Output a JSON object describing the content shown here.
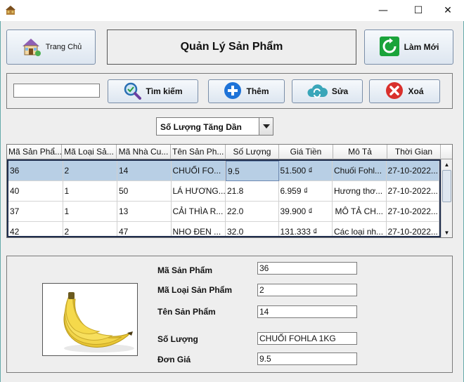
{
  "window": {
    "minimize": "—",
    "maximize": "☐",
    "close": "✕"
  },
  "header": {
    "home_label": "Trang Chủ",
    "title": "Quản Lý Sản Phẩm",
    "refresh_label": "Làm Mới"
  },
  "toolbar": {
    "search_value": "",
    "search_label": "Tìm kiếm",
    "add_label": "Thêm",
    "edit_label": "Sửa",
    "delete_label": "Xoá"
  },
  "sort": {
    "selected": "Số Lượng Tăng Dần"
  },
  "table": {
    "columns": [
      "Mã Sản Phẩ...",
      "Mã Loại Sả...",
      "Mã Nhà Cu...",
      "Tên Sản Ph...",
      "Số Lượng",
      "Giá Tiền",
      "Mô Tả",
      "Thời Gian"
    ],
    "rows": [
      [
        "36",
        "2",
        "14",
        "CHUỐI FO...",
        "9.5",
        "51.500 ₫",
        "Chuối Fohl...",
        "27-10-2022..."
      ],
      [
        "40",
        "1",
        "50",
        "LÁ HƯƠNG...",
        "21.8",
        "6.959 ₫",
        "Hương thơ...",
        "27-10-2022..."
      ],
      [
        "37",
        "1",
        "13",
        "CẢI THÌA R...",
        "22.0",
        "39.900 ₫",
        "MÔ TẢ CH...",
        "27-10-2022..."
      ],
      [
        "42",
        "2",
        "47",
        "NHO ĐEN ...",
        "32.0",
        "131.333 ₫",
        "Các loại nh...",
        "27-10-2022..."
      ]
    ],
    "selected_row": 0
  },
  "detail": {
    "fields": [
      {
        "label": "Mã Sản Phẩm",
        "value": "36"
      },
      {
        "label": "Mã Loại Sản Phẩm",
        "value": "2"
      },
      {
        "label": "Tên Sản Phẩm",
        "value": "14"
      },
      {
        "label": "Số Lượng",
        "value": "CHUỐI FOHLA 1KG"
      },
      {
        "label": "Đơn Giá",
        "value": "9.5"
      }
    ],
    "image_icon": "banana-image"
  },
  "colors": {
    "accent": "#b8cfe5",
    "background": "#eeeeee",
    "add": "#1e73d8",
    "refresh": "#1aa33a",
    "delete": "#d9302c",
    "edit": "#3aa6b9"
  }
}
